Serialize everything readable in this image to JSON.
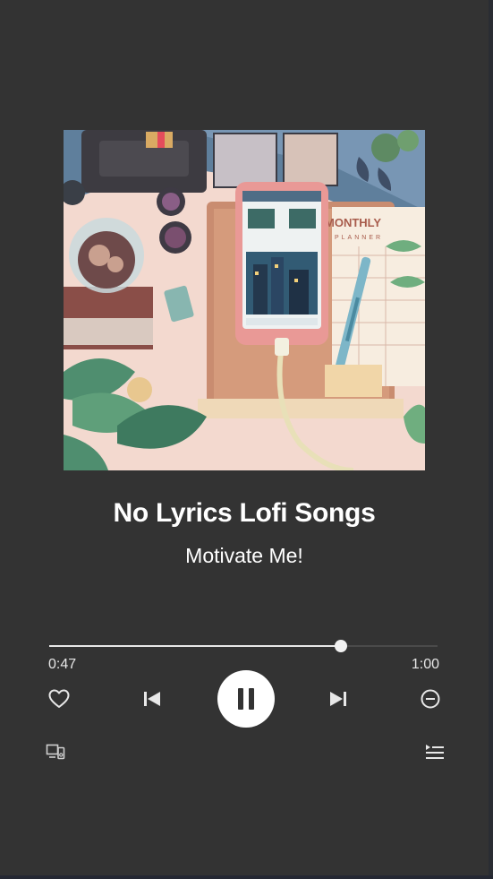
{
  "player": {
    "title": "No Lyrics Lofi Songs",
    "artist": "Motivate Me!",
    "progress": {
      "elapsed": "0:47",
      "duration": "1:00",
      "fraction": 0.75
    }
  },
  "cover_art": {
    "monthly_text": "MONTHLY",
    "planner_text": "PLANNER"
  },
  "icons": {
    "like": "heart-outline-icon",
    "previous": "skip-previous-icon",
    "play_state": "pause-icon",
    "next": "skip-next-icon",
    "remove": "minus-circle-icon",
    "devices": "connect-device-icon",
    "queue": "queue-icon"
  },
  "colors": {
    "background": "#333333",
    "text": "#ffffff",
    "progress_fill": "#e8e8e8",
    "progress_track": "#4a4a4a"
  }
}
